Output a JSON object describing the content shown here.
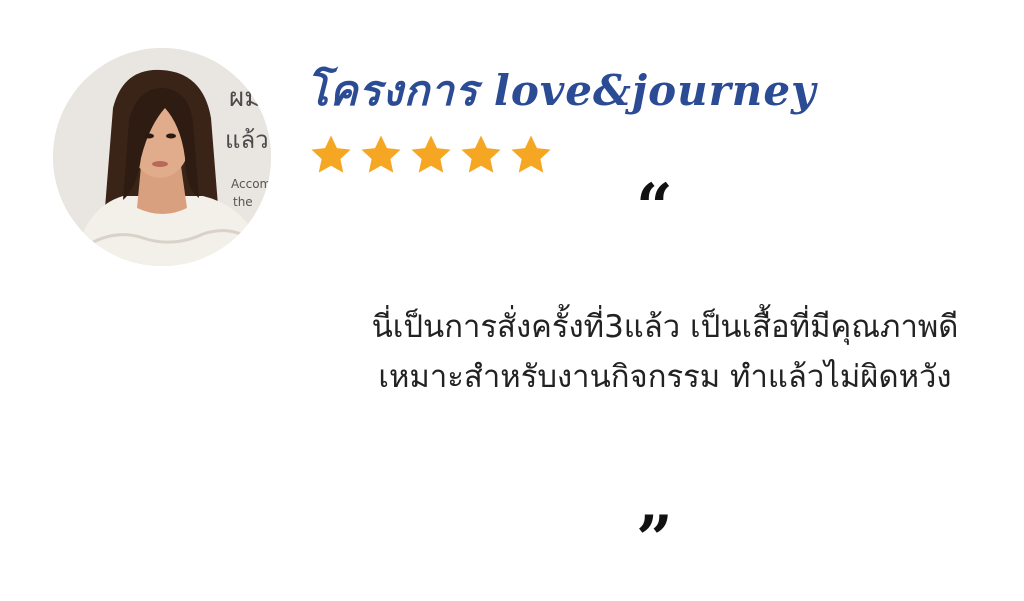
{
  "testimonial": {
    "title": "โครงการ love&journey",
    "rating": 5,
    "rating_max": 5,
    "star_color": "#f5a623",
    "title_color": "#2b4c94",
    "quote_open": "“",
    "quote_close": "”",
    "review_lines": [
      "นี่เป็นการสั่งครั้งที่3แล้ว เป็นเสื้อที่มีคุณภาพดี",
      "เหมาะสำหรับงานกิจกรรม ทำแล้วไม่ผิดหวัง"
    ],
    "avatar": {
      "background_lettering": [
        "ผม",
        "แล้ว",
        "Accom",
        "the"
      ]
    }
  }
}
